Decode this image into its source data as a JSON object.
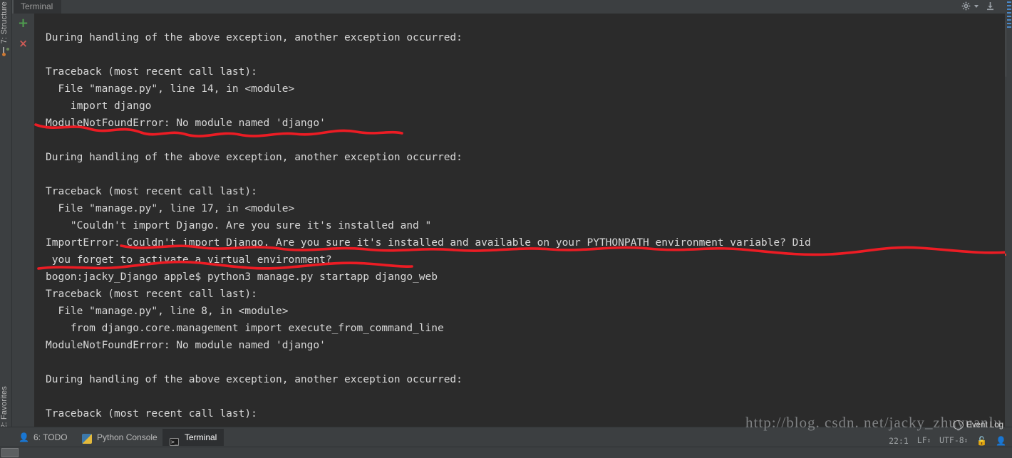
{
  "window": {
    "panel_title": "Terminal"
  },
  "left_strip": {
    "top_tab": {
      "label": "7: Structure",
      "icon": "structure-icon"
    },
    "bottom_tab": {
      "label": "2: Favorites",
      "icon": "star-icon"
    }
  },
  "panel_header": {
    "settings_icon": "gear-icon",
    "dropdown_icon": "chevron-down-icon",
    "hide_icon": "hide-panel-icon"
  },
  "terminal_toolbar": {
    "new_session_label": "+",
    "close_session_label": "×"
  },
  "terminal": {
    "lines": [
      "During handling of the above exception, another exception occurred:",
      "",
      "Traceback (most recent call last):",
      "  File \"manage.py\", line 14, in <module>",
      "    import django",
      "ModuleNotFoundError: No module named 'django'",
      "",
      "During handling of the above exception, another exception occurred:",
      "",
      "Traceback (most recent call last):",
      "  File \"manage.py\", line 17, in <module>",
      "    \"Couldn't import Django. Are you sure it's installed and \"",
      "ImportError: Couldn't import Django. Are you sure it's installed and available on your PYTHONPATH environment variable? Did",
      " you forget to activate a virtual environment?",
      "bogon:jacky_Django apple$ python3 manage.py startapp django_web",
      "Traceback (most recent call last):",
      "  File \"manage.py\", line 8, in <module>",
      "    from django.core.management import execute_from_command_line",
      "ModuleNotFoundError: No module named 'django'",
      "",
      "During handling of the above exception, another exception occurred:",
      "",
      "Traceback (most recent call last):"
    ]
  },
  "bottom_tabs": [
    {
      "label": "6: TODO",
      "mnemonic": "6",
      "rest": ": TODO",
      "icon": "todo-icon",
      "active": false
    },
    {
      "label": "Python Console",
      "icon": "python-icon",
      "active": false
    },
    {
      "label": "Terminal",
      "icon": "terminal-icon",
      "active": true
    }
  ],
  "status_bar": {
    "watermark": "http://blog. csdn. net/jacky_zhuyuanlu",
    "event_log": "Event Log",
    "caret_position": "22:1",
    "line_separator": "LF",
    "encoding": "UTF-8",
    "lock_icon": "lock-icon",
    "hud_icon": "hector-inspection-icon",
    "stepper_glyph": "↕"
  },
  "colors": {
    "terminal_bg": "#2b2b2b",
    "panel_bg": "#3c3f41",
    "terminal_fg": "#d8d8d8",
    "annotation_red": "#ec1c24",
    "accent_add": "#4f9e4f",
    "accent_close": "#cf5b56"
  }
}
